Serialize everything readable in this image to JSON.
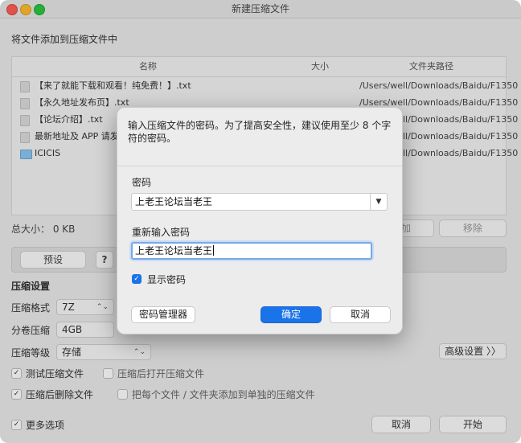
{
  "window": {
    "title": "新建压缩文件"
  },
  "subtitle": "将文件添加到压缩文件中",
  "file_table": {
    "columns": [
      "名称",
      "大小",
      "文件夹路径"
    ],
    "rows": [
      {
        "name": "【来了就能下载和观看！纯免费！】.txt",
        "size": "",
        "path": "/Users/well/Downloads/Baidu/F1350",
        "icon": "document-icon"
      },
      {
        "name": "【永久地址发布页】.txt",
        "size": "",
        "path": "/Users/well/Downloads/Baidu/F1350",
        "icon": "document-icon"
      },
      {
        "name": "【论坛介绍】.txt",
        "size": "",
        "path": "/Users/well/Downloads/Baidu/F1350",
        "icon": "document-icon"
      },
      {
        "name": "最新地址及 APP 请发邮...",
        "size": "",
        "path": "/Users/well/Downloads/Baidu/F1350",
        "icon": "document-icon"
      },
      {
        "name": "ICICIS",
        "size": "",
        "path": "/Users/well/Downloads/Baidu/F1350",
        "icon": "folder-icon"
      }
    ]
  },
  "total_size": "总大小：  0 KB",
  "buttons": {
    "add": "加",
    "remove": "移除",
    "preset": "预设",
    "help": "?",
    "advanced": "高级设置 〉〉",
    "cancel": "取消",
    "start": "开始"
  },
  "compression": {
    "section_title": "压缩设置",
    "format_label": "压缩格式",
    "format_value": "7Z",
    "split_label": "分卷压缩",
    "split_value": "4GB",
    "level_label": "压缩等级",
    "level_value": "存储"
  },
  "options": {
    "test": {
      "label": "测试压缩文件",
      "checked": true
    },
    "open_after": {
      "label": "压缩后打开压缩文件",
      "checked": false
    },
    "delete_after": {
      "label": "压缩后删除文件",
      "checked": true
    },
    "separate": {
      "label": "把每个文件 / 文件夹添加到单独的压缩文件",
      "checked": false
    },
    "more": {
      "label": "更多选项",
      "checked": true
    }
  },
  "dialog": {
    "message": "输入压缩文件的密码。为了提高安全性，建议使用至少 8 个字符的密码。",
    "password_label": "密码",
    "password_value": "上老王论坛当老王",
    "reenter_label": "重新输入密码",
    "reenter_value": "上老王论坛当老王",
    "show_password_label": "显示密码",
    "show_password_checked": true,
    "manager_button": "密码管理器",
    "ok_button": "确定",
    "cancel_button": "取消"
  },
  "colors": {
    "accent": "#1a73e8",
    "close": "#ff5f57",
    "minimize": "#febc2e",
    "zoom": "#28c840"
  }
}
